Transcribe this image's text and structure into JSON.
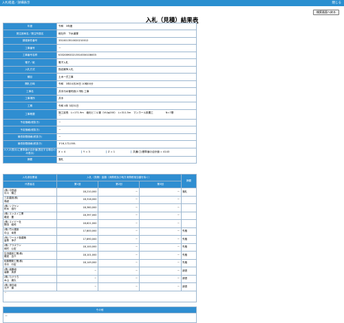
{
  "header": {
    "title": "入札経過／詳細表示",
    "close_label": "閉じる"
  },
  "toolbar": {
    "back_label": "検索画面へ戻る"
  },
  "page": {
    "title": "入札（見積）結果表"
  },
  "info": {
    "rows": [
      {
        "label": "年度",
        "value": "令和　3年度"
      },
      {
        "label": "発注部局名／発注所属名",
        "value": "総社市　下水道課"
      },
      {
        "label": "調達案件番号",
        "value": "3310013510020210012"
      },
      {
        "label": "工事番号",
        "value": "－"
      },
      {
        "label": "工事番号名称",
        "value": "K3320892021351000010800​3"
      },
      {
        "label": "電子／紙",
        "value": "電子入札"
      },
      {
        "label": "入札方式",
        "value": "指名競争入札"
      },
      {
        "label": "種目",
        "value": "土木一式工事"
      },
      {
        "label": "開札日時",
        "value": "令和　3年10月26日 10時00分"
      },
      {
        "label": "工事名",
        "value": "井手汚水管布設(17期) 工事"
      },
      {
        "label": "工事場所",
        "value": "井手"
      },
      {
        "label": "工期",
        "value": "令和 4年 3月31日"
      },
      {
        "label": "工事概要",
        "value": "施工延長　L=171.9m　塩化ビニル管（VU)φ200）　L=311.5m　マンホール設置工　　　　　N=7基",
        "value2": "－"
      },
      {
        "label": "予定価格(税抜き)",
        "value": "－"
      },
      {
        "label": "予定価格(税抜き)",
        "value": "－"
      },
      {
        "label": "最低制限価格(税抜き)",
        "value": "－"
      },
      {
        "label": "最低制限価格(税抜き)",
        "value": "￥16,172,000-"
      }
    ],
    "xyz_label": "X,Y,Z(表示)に基準値の合計値(表記する場合のみ表示)",
    "xyz_values": [
      "X = 4",
      "Y = 3",
      "Z = 1",
      "共通(〇)基準値の合計値 = 4143"
    ],
    "remarks_label": "摘要",
    "remarks_value": "落札"
  },
  "bids": {
    "header_company": "入札参加業者",
    "header_amount": "入札（見積）金額（消費税及び地方消費税相当額を除く）",
    "header_note": "摘要",
    "header_rep": "代表者名",
    "rounds": [
      "第1回",
      "第2回",
      "第3回"
    ],
    "rows": [
      {
        "company": "(株) 中田組",
        "rep": "中川　隆之",
        "r1": "18,210,000",
        "r2": "－",
        "r3": "－",
        "note": "落札"
      },
      {
        "company": "三井建設(株)",
        "rep": "鳥越",
        "r1": "18,316,000",
        "r2": "－",
        "r3": "－",
        "note": ""
      },
      {
        "company": "(株) シマケン",
        "rep": "鈴木　信行",
        "r1": "18,360,000",
        "r2": "－",
        "r3": "－",
        "note": ""
      },
      {
        "company": "(株) エンスイ工業",
        "rep": "難波　豊",
        "r1": "18,397,000",
        "r2": "－",
        "r3": "－",
        "note": ""
      },
      {
        "company": "(株) エイビー社",
        "rep": "野田　耕司",
        "r1": "18,621,000",
        "r2": "－",
        "r3": "－",
        "note": ""
      },
      {
        "company": "(株) 竹川建設",
        "rep": "中山　幸男",
        "r1": "17,800,000",
        "r2": "－",
        "r3": "－",
        "note": "失格"
      },
      {
        "company": "(有) ワールド各建築",
        "rep": "高草　浄子",
        "r1": "17,890,000",
        "r2": "－",
        "r3": "－",
        "note": "失格"
      },
      {
        "company": "(株) アラスワン",
        "rep": "岡村　公宏",
        "r1": "18,100,000",
        "r2": "－",
        "r3": "－",
        "note": "失格"
      },
      {
        "company": "生田建設工業(株)",
        "rep": "難波　吉介",
        "r1": "18,101,000",
        "r2": "－",
        "r3": "－",
        "note": "失格"
      },
      {
        "company": "佐藤開発工業(株)",
        "rep": "洋平　行宏",
        "r1": "18,149,000",
        "r2": "－",
        "r3": "－",
        "note": "失格"
      },
      {
        "company": "(株) 高鶴組",
        "rep": "高鶴　英彦",
        "r1": "－",
        "r2": "－",
        "r3": "－",
        "note": "辞退"
      },
      {
        "company": "(株) たけうち",
        "rep": "木山　康久",
        "r1": "－",
        "r2": "－",
        "r3": "－",
        "note": "辞退"
      },
      {
        "company": "(株) 渡辺組",
        "rep": "元子　倫",
        "r1": "－",
        "r2": "－",
        "r3": "－",
        "note": "辞退"
      }
    ],
    "footer": "－"
  },
  "other": {
    "header": "その他",
    "value": "－"
  }
}
